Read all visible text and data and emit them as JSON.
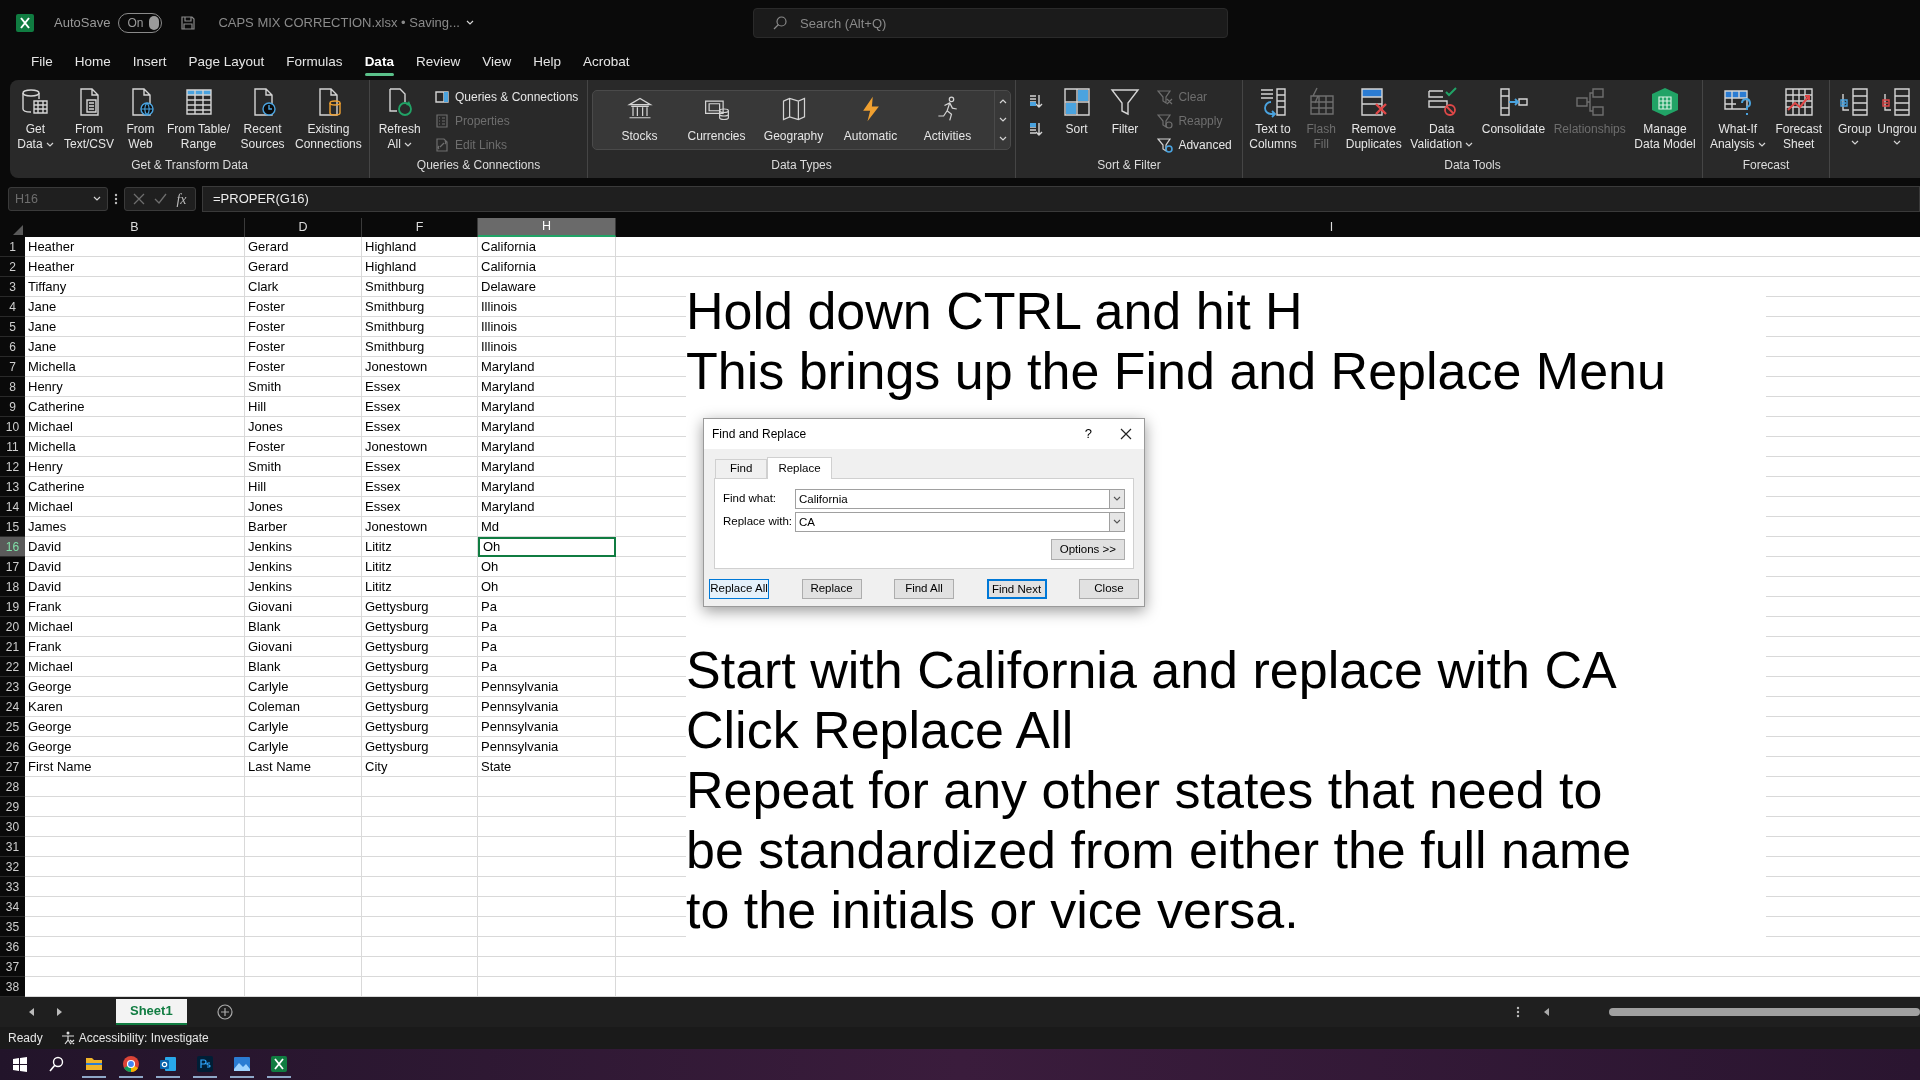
{
  "title_bar": {
    "autosave_label": "AutoSave",
    "autosave": {
      "on": true,
      "label": "On"
    },
    "file_name": "CAPS MIX CORRECTION.xlsx • Saving...",
    "search": {
      "placeholder": "Search (Alt+Q)"
    }
  },
  "menu_tabs": [
    {
      "label": "File",
      "selected": false
    },
    {
      "label": "Home",
      "selected": false
    },
    {
      "label": "Insert",
      "selected": false
    },
    {
      "label": "Page Layout",
      "selected": false
    },
    {
      "label": "Formulas",
      "selected": false
    },
    {
      "label": "Data",
      "selected": true
    },
    {
      "label": "Review",
      "selected": false
    },
    {
      "label": "View",
      "selected": false
    },
    {
      "label": "Help",
      "selected": false
    },
    {
      "label": "Acrobat",
      "selected": false
    }
  ],
  "ribbon": {
    "groups": [
      {
        "label": "Get & Transform Data",
        "buttons": [
          {
            "kind": "large",
            "lines": [
              "Get",
              "Data"
            ],
            "dropdown": true,
            "disabled": false
          },
          {
            "kind": "large",
            "lines": [
              "From",
              "Text/CSV"
            ],
            "dropdown": false,
            "disabled": false
          },
          {
            "kind": "large",
            "lines": [
              "From",
              "Web"
            ],
            "dropdown": false,
            "disabled": false
          },
          {
            "kind": "large",
            "lines": [
              "From Table/",
              "Range"
            ],
            "dropdown": false,
            "disabled": false
          },
          {
            "kind": "large",
            "lines": [
              "Recent",
              "Sources"
            ],
            "dropdown": false,
            "disabled": false
          },
          {
            "kind": "large",
            "lines": [
              "Existing",
              "Connections"
            ],
            "dropdown": false,
            "disabled": false
          }
        ]
      },
      {
        "label": "Queries & Connections",
        "buttons": [
          {
            "kind": "large",
            "lines": [
              "Refresh",
              "All"
            ],
            "dropdown": true,
            "disabled": false
          },
          {
            "kind": "small",
            "lines": [
              "Queries & Connections"
            ],
            "dropdown": false,
            "disabled": false
          },
          {
            "kind": "small",
            "lines": [
              "Properties"
            ],
            "dropdown": false,
            "disabled": true
          },
          {
            "kind": "small",
            "lines": [
              "Edit Links"
            ],
            "dropdown": false,
            "disabled": true
          }
        ]
      },
      {
        "label": "Data Types",
        "buttons": [
          {
            "kind": "gallery",
            "lines": [
              "Stocks"
            ],
            "dropdown": false,
            "disabled": false
          },
          {
            "kind": "gallery",
            "lines": [
              "Currencies"
            ],
            "dropdown": false,
            "disabled": false
          },
          {
            "kind": "gallery",
            "lines": [
              "Geography"
            ],
            "dropdown": false,
            "disabled": false
          },
          {
            "kind": "gallery",
            "lines": [
              "Automatic"
            ],
            "dropdown": false,
            "disabled": false
          },
          {
            "kind": "gallery",
            "lines": [
              "Activities"
            ],
            "dropdown": false,
            "disabled": false
          }
        ]
      },
      {
        "label": "Sort & Filter",
        "buttons": [
          {
            "kind": "icon",
            "dropdown": false,
            "disabled": false
          },
          {
            "kind": "icon",
            "dropdown": false,
            "disabled": false
          },
          {
            "kind": "large",
            "lines": [
              "Sort"
            ],
            "dropdown": false,
            "disabled": false
          },
          {
            "kind": "large",
            "lines": [
              "Filter"
            ],
            "dropdown": false,
            "disabled": false
          },
          {
            "kind": "small",
            "lines": [
              "Clear"
            ],
            "dropdown": false,
            "disabled": true
          },
          {
            "kind": "small",
            "lines": [
              "Reapply"
            ],
            "dropdown": false,
            "disabled": true
          },
          {
            "kind": "small",
            "lines": [
              "Advanced"
            ],
            "dropdown": false,
            "disabled": false
          }
        ]
      },
      {
        "label": "Data Tools",
        "buttons": [
          {
            "kind": "large",
            "lines": [
              "Text to",
              "Columns"
            ],
            "dropdown": false,
            "disabled": false
          },
          {
            "kind": "large",
            "lines": [
              "Flash",
              "Fill"
            ],
            "dropdown": false,
            "disabled": true
          },
          {
            "kind": "large",
            "lines": [
              "Remove",
              "Duplicates"
            ],
            "dropdown": false,
            "disabled": false
          },
          {
            "kind": "large",
            "lines": [
              "Data",
              "Validation"
            ],
            "dropdown": true,
            "disabled": false
          },
          {
            "kind": "large",
            "lines": [
              "Consolidate"
            ],
            "dropdown": false,
            "disabled": false
          },
          {
            "kind": "large",
            "lines": [
              "Relationships"
            ],
            "dropdown": false,
            "disabled": true
          },
          {
            "kind": "large",
            "lines": [
              "Manage",
              "Data Model"
            ],
            "dropdown": false,
            "disabled": false
          }
        ]
      },
      {
        "label": "Forecast",
        "buttons": [
          {
            "kind": "large",
            "lines": [
              "What-If",
              "Analysis"
            ],
            "dropdown": true,
            "disabled": false
          },
          {
            "kind": "large",
            "lines": [
              "Forecast",
              "Sheet"
            ],
            "dropdown": false,
            "disabled": false
          }
        ]
      },
      {
        "buttons": [
          {
            "kind": "large",
            "lines": [
              "Group"
            ],
            "dropdown": true,
            "disabled": false
          },
          {
            "kind": "large",
            "lines": [
              "Ungrou"
            ],
            "dropdown": true,
            "disabled": false
          }
        ]
      }
    ]
  },
  "formula_bar": {
    "name_box": "H16",
    "function_label": "fx",
    "formula": "=PROPER(G16)"
  },
  "sheet": {
    "columns": [
      {
        "label": "B",
        "selected": false
      },
      {
        "label": "D",
        "selected": false
      },
      {
        "label": "F",
        "selected": false
      },
      {
        "label": "H",
        "selected": true
      },
      {
        "label": "I",
        "selected": false
      }
    ],
    "rows": [
      {
        "number": "1",
        "selected": false,
        "cells": [
          "Heather",
          "Gerard",
          "Highland",
          "California"
        ]
      },
      {
        "number": "2",
        "selected": false,
        "cells": [
          "Heather",
          "Gerard",
          "Highland",
          "California"
        ]
      },
      {
        "number": "3",
        "selected": false,
        "cells": [
          "Tiffany",
          "Clark",
          "Smithburg",
          "Delaware"
        ]
      },
      {
        "number": "4",
        "selected": false,
        "cells": [
          "Jane",
          "Foster",
          "Smithburg",
          "Illinois"
        ]
      },
      {
        "number": "5",
        "selected": false,
        "cells": [
          "Jane",
          "Foster",
          "Smithburg",
          "Illinois"
        ]
      },
      {
        "number": "6",
        "selected": false,
        "cells": [
          "Jane",
          "Foster",
          "Smithburg",
          "Illinois"
        ]
      },
      {
        "number": "7",
        "selected": false,
        "cells": [
          "Michella",
          "Foster",
          "Jonestown",
          "Maryland"
        ]
      },
      {
        "number": "8",
        "selected": false,
        "cells": [
          "Henry",
          "Smith",
          "Essex",
          "Maryland"
        ]
      },
      {
        "number": "9",
        "selected": false,
        "cells": [
          "Catherine",
          "Hill",
          "Essex",
          "Maryland"
        ]
      },
      {
        "number": "10",
        "selected": false,
        "cells": [
          "Michael",
          "Jones",
          "Essex",
          "Maryland"
        ]
      },
      {
        "number": "11",
        "selected": false,
        "cells": [
          "Michella",
          "Foster",
          "Jonestown",
          "Maryland"
        ]
      },
      {
        "number": "12",
        "selected": false,
        "cells": [
          "Henry",
          "Smith",
          "Essex",
          "Maryland"
        ]
      },
      {
        "number": "13",
        "selected": false,
        "cells": [
          "Catherine",
          "Hill",
          "Essex",
          "Maryland"
        ]
      },
      {
        "number": "14",
        "selected": false,
        "cells": [
          "Michael",
          "Jones",
          "Essex",
          "Maryland"
        ]
      },
      {
        "number": "15",
        "selected": false,
        "cells": [
          "James",
          "Barber",
          "Jonestown",
          "Md"
        ]
      },
      {
        "number": "16",
        "selected": true,
        "cells": [
          "David",
          "Jenkins",
          "Lititz",
          "Oh"
        ]
      },
      {
        "number": "17",
        "selected": false,
        "cells": [
          "David",
          "Jenkins",
          "Lititz",
          "Oh"
        ]
      },
      {
        "number": "18",
        "selected": false,
        "cells": [
          "David",
          "Jenkins",
          "Lititz",
          "Oh"
        ]
      },
      {
        "number": "19",
        "selected": false,
        "cells": [
          "Frank",
          "Giovani",
          "Gettysburg",
          "Pa"
        ]
      },
      {
        "number": "20",
        "selected": false,
        "cells": [
          "Michael",
          "Blank",
          "Gettysburg",
          "Pa"
        ]
      },
      {
        "number": "21",
        "selected": false,
        "cells": [
          "Frank",
          "Giovani",
          "Gettysburg",
          "Pa"
        ]
      },
      {
        "number": "22",
        "selected": false,
        "cells": [
          "Michael",
          "Blank",
          "Gettysburg",
          "Pa"
        ]
      },
      {
        "number": "23",
        "selected": false,
        "cells": [
          "George",
          "Carlyle",
          "Gettysburg",
          "Pennsylvania"
        ]
      },
      {
        "number": "24",
        "selected": false,
        "cells": [
          "Karen",
          "Coleman",
          "Gettysburg",
          "Pennsylvania"
        ]
      },
      {
        "number": "25",
        "selected": false,
        "cells": [
          "George",
          "Carlyle",
          "Gettysburg",
          "Pennsylvania"
        ]
      },
      {
        "number": "26",
        "selected": false,
        "cells": [
          "George",
          "Carlyle",
          "Gettysburg",
          "Pennsylvania"
        ]
      },
      {
        "number": "27",
        "selected": false,
        "cells": [
          "First Name",
          "Last Name",
          "City",
          "State"
        ]
      },
      {
        "number": "28",
        "selected": false
      },
      {
        "number": "29",
        "selected": false
      },
      {
        "number": "30",
        "selected": false
      },
      {
        "number": "31",
        "selected": false
      },
      {
        "number": "32",
        "selected": false
      },
      {
        "number": "33",
        "selected": false
      },
      {
        "number": "34",
        "selected": false
      },
      {
        "number": "35",
        "selected": false
      },
      {
        "number": "36",
        "selected": false
      },
      {
        "number": "37",
        "selected": false
      },
      {
        "number": "38",
        "selected": false
      }
    ]
  },
  "text_box": {
    "paragraphs": [
      [
        "Hold down CTRL and hit H",
        "This brings up the Find and Replace Menu"
      ],
      [
        "Start with California and replace with CA",
        "Click Replace All",
        "Repeat for any other states that need to",
        "be standardized from either the full name",
        "to the initials or vice versa."
      ]
    ]
  },
  "dialog": {
    "title": "Find and Replace",
    "help": "?",
    "tabs": [
      {
        "label": "Find",
        "selected": false
      },
      {
        "label": "Replace",
        "selected": true
      }
    ],
    "fields": [
      {
        "label": "Find what:",
        "value": "California"
      },
      {
        "label": "Replace with:",
        "value": "CA"
      }
    ],
    "options_button": "Options >>",
    "buttons": [
      {
        "label": "Replace All",
        "focused": true,
        "default": false
      },
      {
        "label": "Replace",
        "focused": false,
        "default": false
      },
      {
        "label": "Find All",
        "focused": false,
        "default": false
      },
      {
        "label": "Find Next",
        "focused": false,
        "default": true
      },
      {
        "label": "Close",
        "focused": false,
        "default": false
      }
    ]
  },
  "sheet_tabs": [
    {
      "label": "Sheet1",
      "selected": true
    }
  ],
  "status_bar": {
    "status": "Ready",
    "accessibility": "Accessibility: Investigate"
  }
}
